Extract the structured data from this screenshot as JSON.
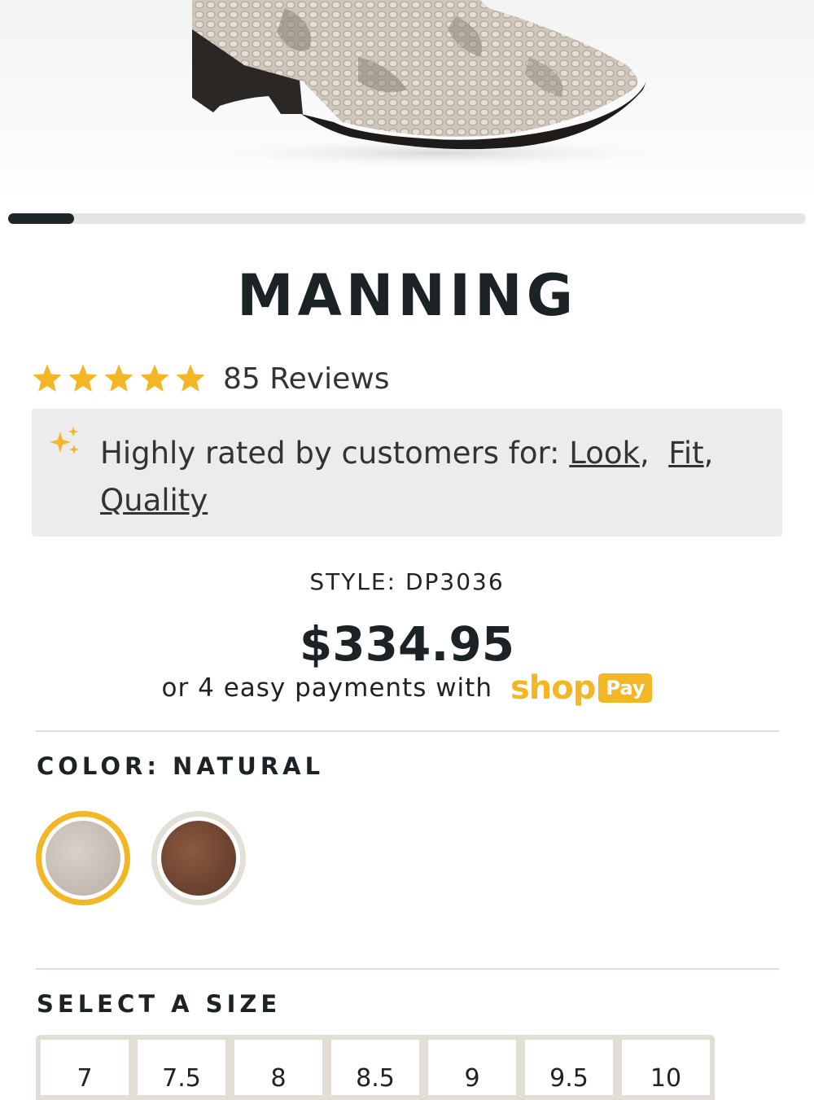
{
  "gallery": {
    "image_alt": "Natural python snakeskin western boot",
    "progress_fraction": 0.083
  },
  "product": {
    "title": "MANNING",
    "rating": 5,
    "reviews_label": "85 Reviews",
    "highlight": {
      "prefix": "Highly rated by customers for:",
      "attributes": [
        "Look",
        "Fit",
        "Quality"
      ]
    },
    "style_label": "STYLE: DP3036",
    "price": "$334.95",
    "installments_text": "or 4 easy payments with",
    "shop_pay": {
      "word": "shop",
      "badge": "Pay"
    }
  },
  "color": {
    "label": "COLOR: NATURAL",
    "options": [
      {
        "name": "Natural",
        "hex": "#c8bfb5",
        "selected": true
      },
      {
        "name": "Brown",
        "hex": "#6e4634",
        "selected": false
      }
    ]
  },
  "size": {
    "label": "SELECT A SIZE",
    "options": [
      "7",
      "7.5",
      "8",
      "8.5",
      "9",
      "9.5",
      "10"
    ]
  },
  "colors": {
    "accent": "#f3b624",
    "text": "#1c2326",
    "divider": "#e2ddd5"
  }
}
